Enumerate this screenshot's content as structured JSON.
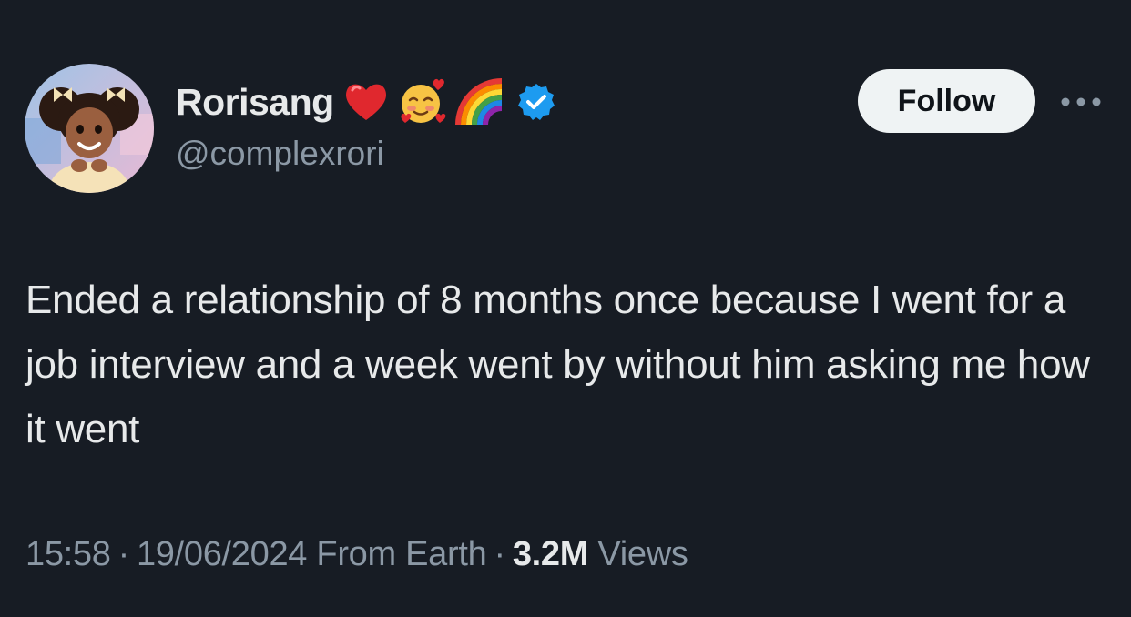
{
  "author": {
    "display_name": "Rorisang",
    "handle": "@complexrori",
    "name_emojis": [
      "red-heart-icon",
      "smiling-face-with-hearts-icon",
      "rainbow-icon"
    ],
    "verified": true
  },
  "actions": {
    "follow_label": "Follow",
    "more_icon": "more-horizontal-icon"
  },
  "tweet": {
    "text": "Ended a relationship of 8 months once because I went for a job interview and a week went by without him asking me how it went"
  },
  "meta": {
    "time": "15:58",
    "date": "19/06/2024",
    "source": "From Earth",
    "separator": "·",
    "views_count": "3.2M",
    "views_label": "Views"
  },
  "colors": {
    "background": "#171c24",
    "text_primary": "#e7e9ea",
    "text_secondary": "#8b98a5",
    "verified_blue": "#1d9bf0",
    "follow_bg": "#eff3f4"
  }
}
